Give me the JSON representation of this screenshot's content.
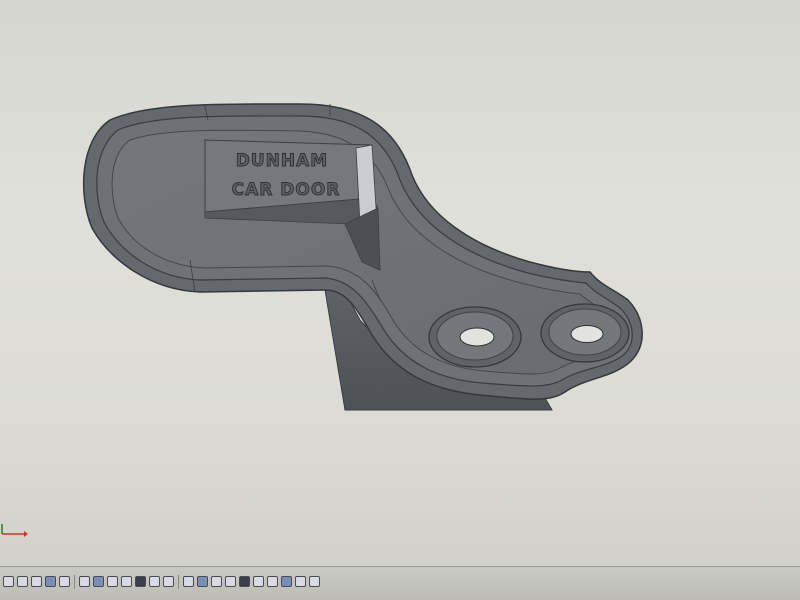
{
  "viewport": {
    "engraving": {
      "line1": "DUNHAM",
      "line2": "CAR DOOR"
    },
    "part_color": "#6b6e73",
    "background_color": "#dcdcd5"
  },
  "toolbar": {
    "icons": [
      "select-icon",
      "zoom-icon",
      "rotate-icon",
      "pan-icon",
      "fit-icon",
      "view-front-icon",
      "view-top-icon",
      "view-right-icon",
      "view-iso-icon",
      "section-icon",
      "shaded-icon",
      "wireframe-icon",
      "hidden-line-icon",
      "sketch-icon",
      "extrude-icon",
      "cut-icon",
      "fillet-icon",
      "chamfer-icon",
      "hole-icon",
      "mirror-icon",
      "pattern-icon",
      "measure-icon",
      "appearance-icon",
      "settings-icon"
    ]
  }
}
